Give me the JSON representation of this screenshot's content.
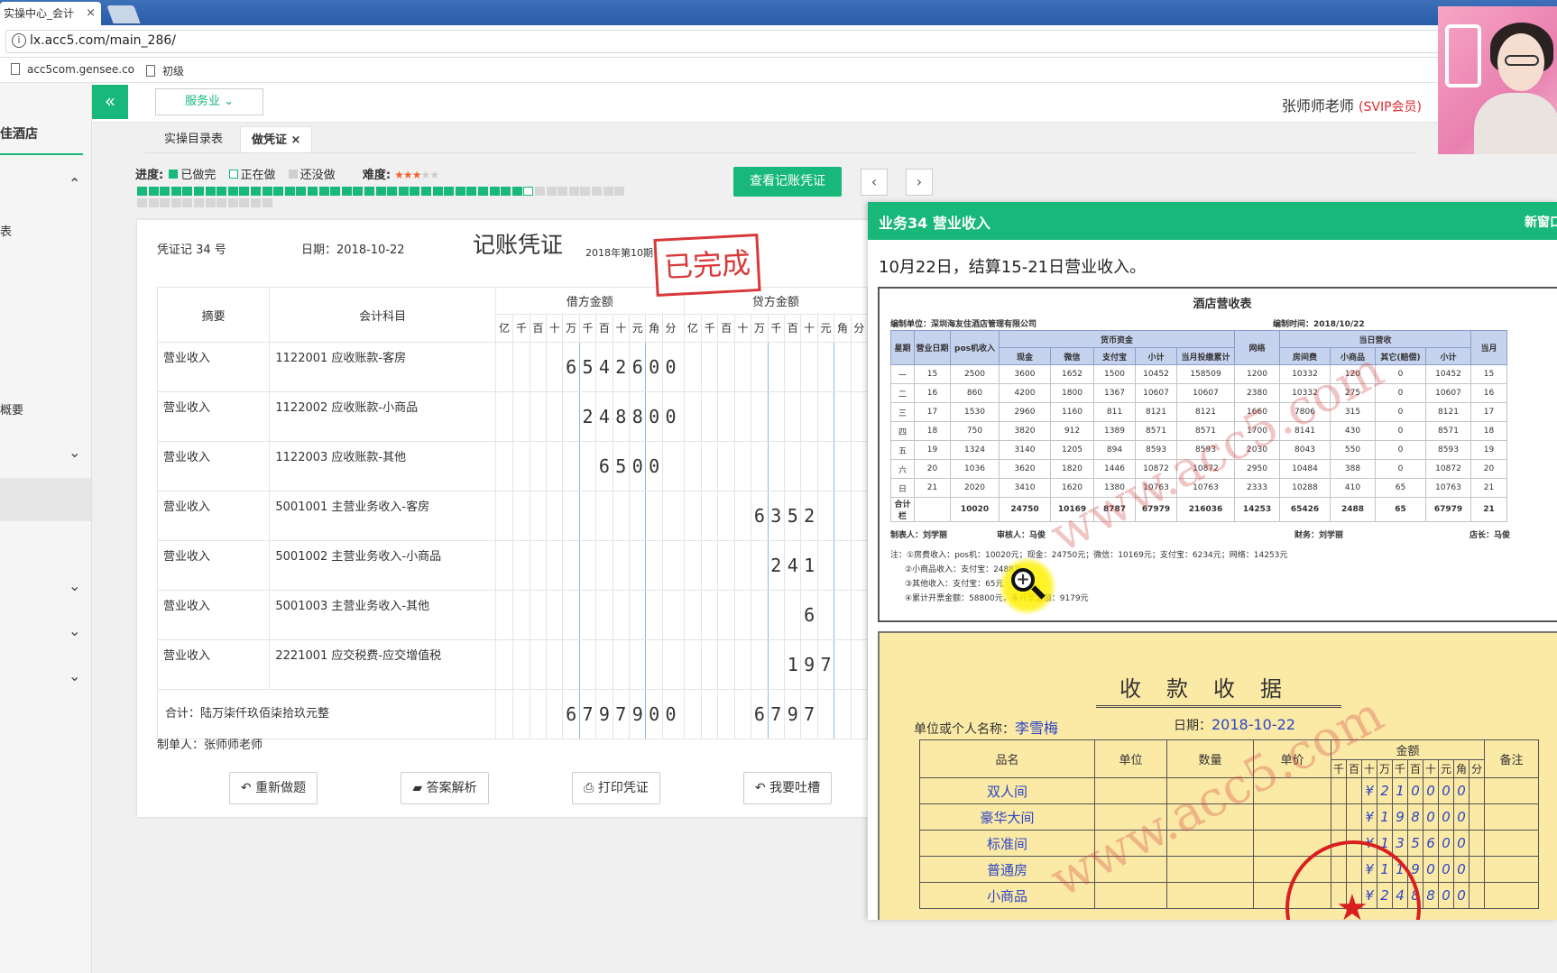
{
  "browser": {
    "tab_title": "实操中心_会计",
    "tab_close": "×",
    "url": "lx.acc5.com/main_286/",
    "info_glyph": "i",
    "bookmarks": [
      "acc5com.gensee.co",
      "初级"
    ]
  },
  "sidebar": {
    "title": "佳酒店",
    "items": [
      "表",
      "概要"
    ],
    "chevron_up": "⌃",
    "chevron_down": "⌄"
  },
  "header": {
    "collapse_glyph": "«",
    "industry": "服务业 ⌄",
    "user_name": "张师师老师",
    "user_badge": "(SVIP会员)"
  },
  "tabs": [
    {
      "label": "实操目录表"
    },
    {
      "label": "做凭证",
      "close": "×"
    }
  ],
  "progress": {
    "label": "进度:",
    "done": "已做完",
    "doing": "正在做",
    "todo": "还没做",
    "difficulty_label": "难度:",
    "difficulty": 3,
    "difficulty_max": 5,
    "star_glyph": "★",
    "done_count": 34,
    "current_index": 34,
    "total": 55,
    "colors": {
      "done": "#17b87a",
      "doing": "#ffffff",
      "todo": "#d6d6d6"
    }
  },
  "buttons": {
    "view_voucher": "查看记账凭证",
    "prev": "‹",
    "next": "›"
  },
  "voucher": {
    "number": "凭证记 34 号",
    "date": "日期：2018-10-22",
    "title": "记账凭证",
    "period": "2018年第10期",
    "stamp": "已完成",
    "col_summary": "摘要",
    "col_account": "会计科目",
    "col_debit": "借方金额",
    "col_credit": "贷方金额",
    "digit_headers": [
      "亿",
      "千",
      "百",
      "十",
      "万",
      "千",
      "百",
      "十",
      "元",
      "角",
      "分"
    ],
    "rows": [
      {
        "summary": "营业收入",
        "account": "1122001 应收账款-客房",
        "debit": [
          "",
          "",
          "",
          "",
          "6",
          "5",
          "4",
          "2",
          "6",
          "0",
          "0"
        ],
        "credit": [
          "",
          "",
          "",
          "",
          "",
          "",
          "",
          "",
          "",
          "",
          ""
        ]
      },
      {
        "summary": "营业收入",
        "account": "1122002 应收账款-小商品",
        "debit": [
          "",
          "",
          "",
          "",
          "",
          "2",
          "4",
          "8",
          "8",
          "0",
          "0"
        ],
        "credit": [
          "",
          "",
          "",
          "",
          "",
          "",
          "",
          "",
          "",
          "",
          ""
        ]
      },
      {
        "summary": "营业收入",
        "account": "1122003 应收账款-其他",
        "debit": [
          "",
          "",
          "",
          "",
          "",
          "",
          "6",
          "5",
          "0",
          "0",
          ""
        ],
        "credit": [
          "",
          "",
          "",
          "",
          "",
          "",
          "",
          "",
          "",
          "",
          ""
        ]
      },
      {
        "summary": "营业收入",
        "account": "5001001 主营业务收入-客房",
        "debit": [
          "",
          "",
          "",
          "",
          "",
          "",
          "",
          "",
          "",
          "",
          ""
        ],
        "credit": [
          "",
          "",
          "",
          "",
          "6",
          "3",
          "5",
          "2",
          "",
          "",
          ""
        ]
      },
      {
        "summary": "营业收入",
        "account": "5001002 主营业务收入-小商品",
        "debit": [
          "",
          "",
          "",
          "",
          "",
          "",
          "",
          "",
          "",
          "",
          ""
        ],
        "credit": [
          "",
          "",
          "",
          "",
          "",
          "2",
          "4",
          "1",
          "",
          "",
          ""
        ]
      },
      {
        "summary": "营业收入",
        "account": "5001003 主营业务收入-其他",
        "debit": [
          "",
          "",
          "",
          "",
          "",
          "",
          "",
          "",
          "",
          "",
          ""
        ],
        "credit": [
          "",
          "",
          "",
          "",
          "",
          "",
          "",
          "6",
          "",
          "",
          ""
        ]
      },
      {
        "summary": "营业收入",
        "account": "2221001 应交税费-应交增值税",
        "debit": [
          "",
          "",
          "",
          "",
          "",
          "",
          "",
          "",
          "",
          "",
          ""
        ],
        "credit": [
          "",
          "",
          "",
          "",
          "",
          "",
          "1",
          "9",
          "7",
          "",
          ""
        ]
      }
    ],
    "total_label": "合计：陆万柒仟玖佰柒拾玖元整",
    "total_debit": [
      "",
      "",
      "",
      "",
      "6",
      "7",
      "9",
      "7",
      "9",
      "0",
      "0"
    ],
    "total_credit": [
      "",
      "",
      "",
      "",
      "6",
      "7",
      "9",
      "7",
      "",
      "",
      ""
    ],
    "maker": "制单人：张师师老师"
  },
  "actions": [
    {
      "icon": "↶",
      "label": "重新做题"
    },
    {
      "icon": "▰",
      "label": "答案解析"
    },
    {
      "icon": "⎙",
      "label": "打印凭证"
    },
    {
      "icon": "↶",
      "label": "我要吐槽"
    }
  ],
  "panel": {
    "title": "业务34 营业收入",
    "new_window": "新窗口",
    "description": "10月22日，结算15-21日营业收入。",
    "report": {
      "title": "酒店营收表",
      "unit": "编制单位：深圳海友住酒店管理有限公司",
      "time": "编制时间：2018/10/22",
      "group_cash": "货币资金",
      "group_rev": "当日营收",
      "group_last": "当月",
      "headers": [
        "星期",
        "营业日期",
        "pos机收入",
        "现金",
        "微信",
        "支付宝",
        "小计",
        "当月投缴累计",
        "网络",
        "房间费",
        "小商品",
        "其它(赔偿)",
        "小计",
        "当月累"
      ],
      "rows": [
        [
          "一",
          "15",
          "2500",
          "3600",
          "1652",
          "1500",
          "10452",
          "158509",
          "1200",
          "10332",
          "120",
          "0",
          "10452",
          "15"
        ],
        [
          "二",
          "16",
          "860",
          "4200",
          "1800",
          "1367",
          "10607",
          "10607",
          "2380",
          "10332",
          "275",
          "0",
          "10607",
          "16"
        ],
        [
          "三",
          "17",
          "1530",
          "2960",
          "1160",
          "811",
          "8121",
          "8121",
          "1660",
          "7806",
          "315",
          "0",
          "8121",
          "17"
        ],
        [
          "四",
          "18",
          "750",
          "3820",
          "912",
          "1389",
          "8571",
          "8571",
          "1700",
          "8141",
          "430",
          "0",
          "8571",
          "18"
        ],
        [
          "五",
          "19",
          "1324",
          "3140",
          "1205",
          "894",
          "8593",
          "8593",
          "2030",
          "8043",
          "550",
          "0",
          "8593",
          "19"
        ],
        [
          "六",
          "20",
          "1036",
          "3620",
          "1820",
          "1446",
          "10872",
          "10872",
          "2950",
          "10484",
          "388",
          "0",
          "10872",
          "20"
        ],
        [
          "日",
          "21",
          "2020",
          "3410",
          "1620",
          "1380",
          "10763",
          "10763",
          "2333",
          "10288",
          "410",
          "65",
          "10763",
          "21"
        ]
      ],
      "total_row": [
        "合计栏",
        "",
        "10020",
        "24750",
        "10169",
        "8787",
        "67979",
        "216036",
        "14253",
        "65426",
        "2488",
        "65",
        "67979",
        "21"
      ],
      "signers": [
        "制表人：刘学丽",
        "审核人：马俊",
        "财务：刘学丽",
        "店长：马俊"
      ],
      "notes": [
        "注：①房费收入：pos机：10020元；现金：24750元；微信：10169元；支付宝：6234元；网络：14253元",
        "②小商品收入：支付宝：2488元",
        "③其他收入：支付宝：65元",
        "④累计开票金额：58800元，未开票金额：9179元"
      ],
      "watermark": "www.acc5.com"
    },
    "receipt": {
      "title": "收款收据",
      "payer_label": "单位或个人名称：",
      "payer": "李雪梅",
      "date_label": "日期：",
      "date": "2018-10-22",
      "col_item": "品名",
      "col_unit": "单位",
      "col_qty": "数量",
      "col_price": "单价",
      "col_amount": "金额",
      "col_note": "备注",
      "amount_digits": [
        "千",
        "百",
        "十",
        "万",
        "千",
        "百",
        "十",
        "元",
        "角",
        "分"
      ],
      "rows": [
        {
          "item": "双人间",
          "amount": [
            "",
            "",
            "¥",
            "2",
            "1",
            "0",
            "0",
            "0",
            "0",
            ""
          ]
        },
        {
          "item": "豪华大间",
          "amount": [
            "",
            "",
            "¥",
            "1",
            "9",
            "8",
            "0",
            "0",
            "0",
            ""
          ]
        },
        {
          "item": "标准间",
          "amount": [
            "",
            "",
            "¥",
            "1",
            "3",
            "5",
            "6",
            "0",
            "0",
            ""
          ]
        },
        {
          "item": "普通房",
          "amount": [
            "",
            "",
            "¥",
            "1",
            "1",
            "9",
            "0",
            "0",
            "0",
            ""
          ]
        },
        {
          "item": "小商品",
          "amount": [
            "",
            "",
            "¥",
            "2",
            "4",
            "8",
            "8",
            "0",
            "0",
            ""
          ]
        }
      ],
      "watermark": "www.acc5.com",
      "seal_star": "★"
    }
  }
}
